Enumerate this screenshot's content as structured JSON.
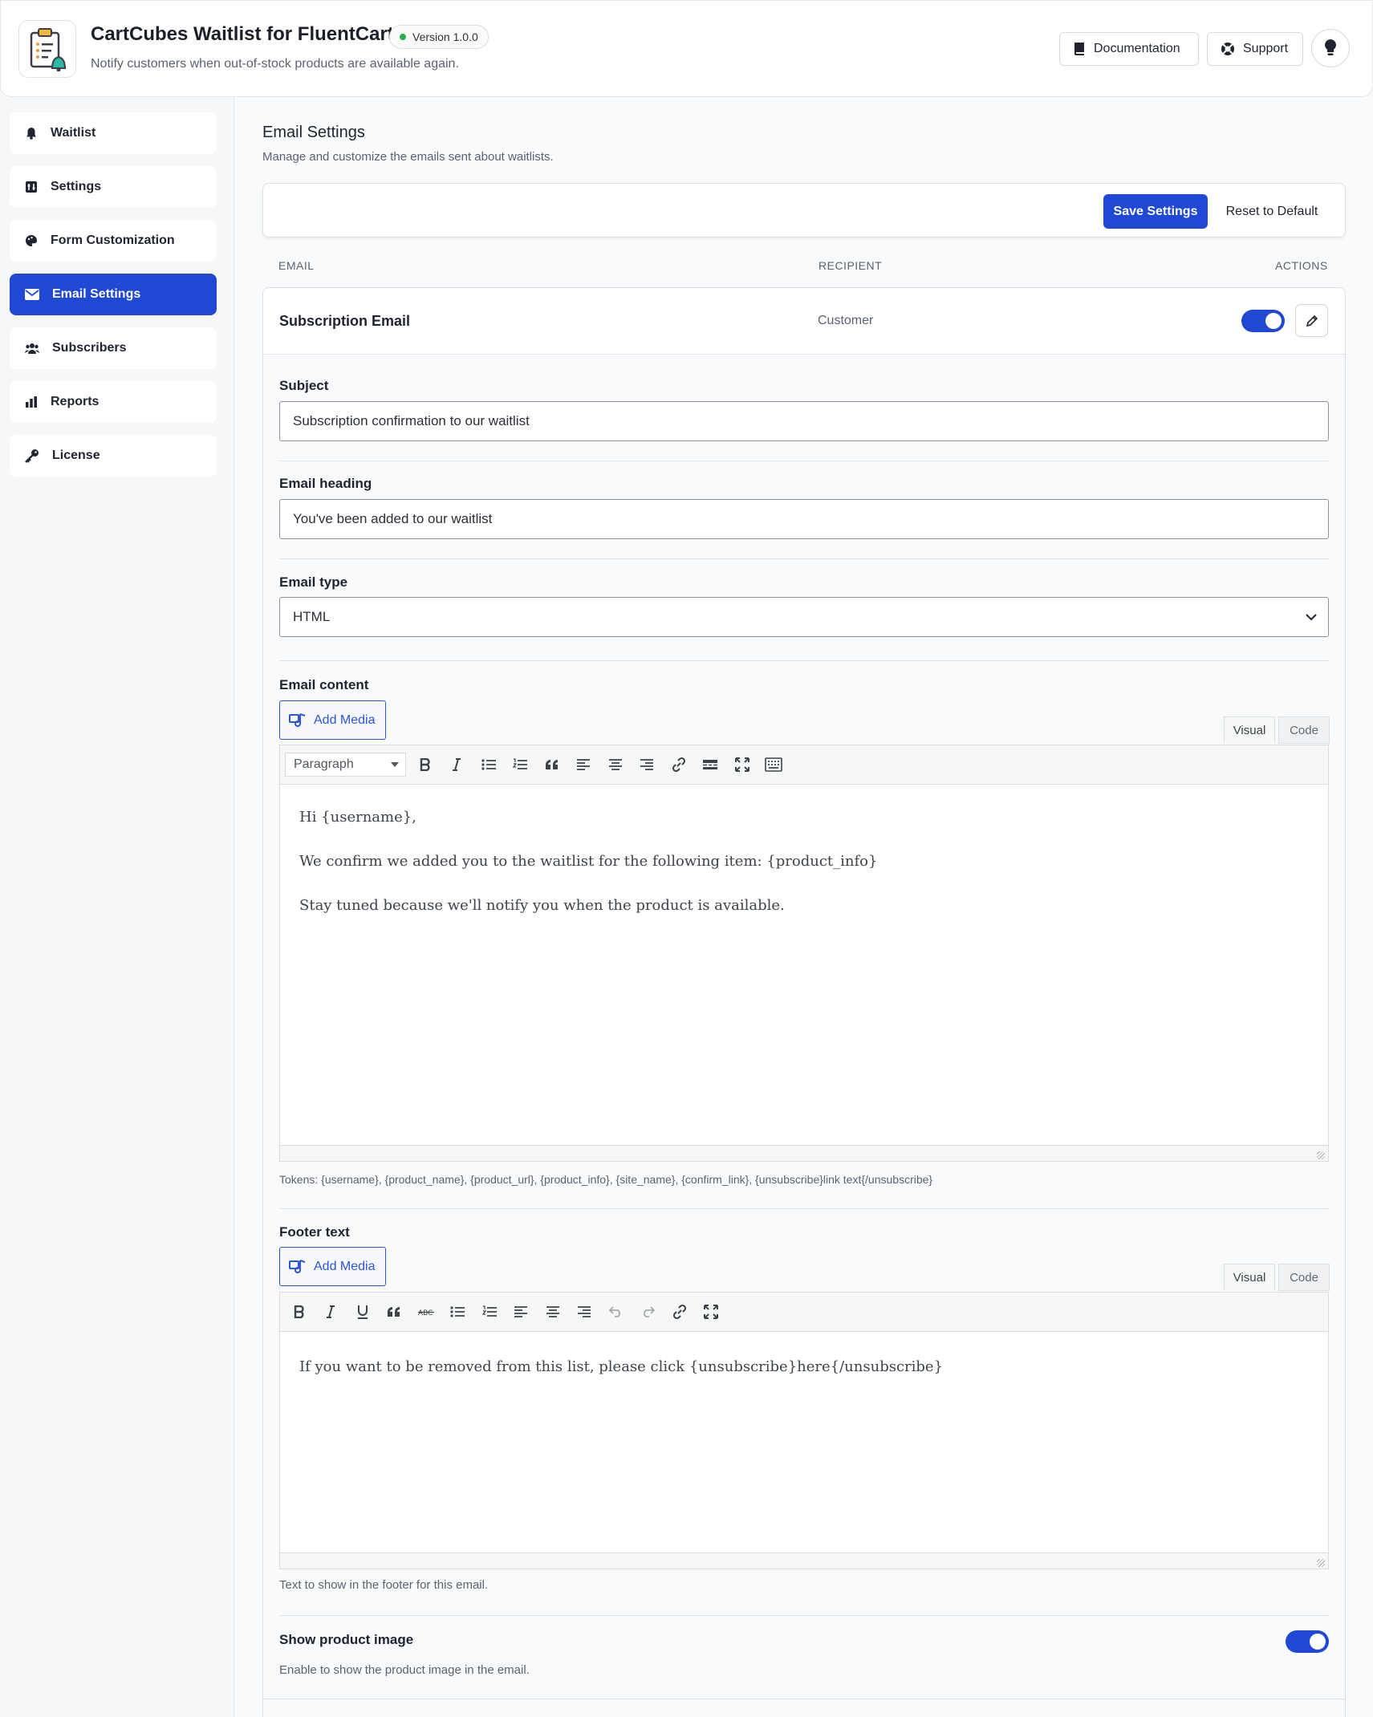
{
  "header": {
    "title": "CartCubes Waitlist for FluentCart",
    "version": "Version 1.0.0",
    "subtitle": "Notify customers when out-of-stock products are available again.",
    "documentation_label": "Documentation",
    "support_label": "Support"
  },
  "sidebar": {
    "items": [
      {
        "label": "Waitlist",
        "icon": "bell-icon"
      },
      {
        "label": "Settings",
        "icon": "settings-sliders-icon"
      },
      {
        "label": "Form Customization",
        "icon": "palette-icon"
      },
      {
        "label": "Email Settings",
        "icon": "envelope-icon",
        "active": true
      },
      {
        "label": "Subscribers",
        "icon": "users-icon"
      },
      {
        "label": "Reports",
        "icon": "bar-chart-icon"
      },
      {
        "label": "License",
        "icon": "key-icon"
      }
    ]
  },
  "page": {
    "title": "Email Settings",
    "subtitle": "Manage and customize the emails sent about waitlists.",
    "save_label": "Save Settings",
    "reset_label": "Reset to Default"
  },
  "table": {
    "headers": {
      "email": "EMAIL",
      "recipient": "RECIPIENT",
      "actions": "ACTIONS"
    },
    "row": {
      "name": "Subscription Email",
      "recipient": "Customer",
      "enabled": true
    }
  },
  "form": {
    "subject": {
      "label": "Subject",
      "value": "Subscription confirmation to our waitlist"
    },
    "heading": {
      "label": "Email heading",
      "value": "You've been added to our waitlist"
    },
    "type": {
      "label": "Email type",
      "value": "HTML"
    },
    "content": {
      "label": "Email content",
      "add_media": "Add Media",
      "tab_visual": "Visual",
      "tab_code": "Code",
      "format_select": "Paragraph",
      "paragraphs": [
        "Hi {username},",
        "We confirm we added you to the waitlist for the following item: {product_info}",
        "Stay tuned because we'll notify you when the product is available."
      ],
      "tokens_help": "Tokens: {username}, {product_name}, {product_url}, {product_info}, {site_name}, {confirm_link}, {unsubscribe}link text{/unsubscribe}"
    },
    "footer": {
      "label": "Footer text",
      "add_media": "Add Media",
      "tab_visual": "Visual",
      "tab_code": "Code",
      "text": "If you want to be removed from this list, please click {unsubscribe}here{/unsubscribe}",
      "help": "Text to show in the footer for this email."
    },
    "product_image": {
      "label": "Show product image",
      "help": "Enable to show the product image in the email.",
      "enabled": true
    }
  },
  "colors": {
    "accent": "#1f49d4",
    "active_nav": "#1f49d4"
  }
}
